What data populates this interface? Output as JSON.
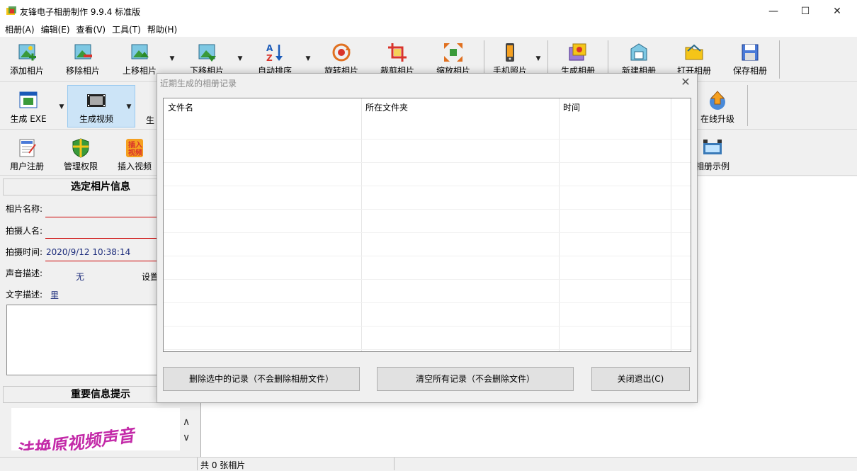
{
  "app": {
    "title": "友锋电子相册制作 9.9.4 标准版",
    "window_buttons": [
      "—",
      "☐",
      "✕"
    ]
  },
  "menu": [
    "相册(A)",
    "编辑(E)",
    "查看(V)",
    "工具(T)",
    "帮助(H)"
  ],
  "toolbar1": [
    {
      "label": "添加相片"
    },
    {
      "label": "移除相片"
    },
    {
      "label": "上移相片"
    },
    {
      "label": "下移相片"
    },
    {
      "label": "自动排序"
    },
    {
      "label": "旋转相片"
    },
    {
      "label": "裁剪相片"
    },
    {
      "label": "缩放相片"
    },
    {
      "label": "手机照片"
    },
    {
      "label": "生成相册"
    },
    {
      "label": "新建相册"
    },
    {
      "label": "打开相册"
    },
    {
      "label": "保存相册"
    }
  ],
  "toolbar2": [
    {
      "label": "生成 EXE"
    },
    {
      "label": "生成视频"
    },
    {
      "label": "生"
    },
    {
      "label": "在线升级"
    }
  ],
  "toolbar3": [
    {
      "label": "用户注册"
    },
    {
      "label": "管理权限"
    },
    {
      "label": "插入视频"
    },
    {
      "label": "相册示例"
    }
  ],
  "info_panel": {
    "header": "选定相片信息",
    "name_label": "相片名称:",
    "shooter_label": "拍摄人名:",
    "time_label": "拍摄时间:",
    "time_value": "2020/9/12 10:38:14",
    "sound_label": "声音描述:",
    "sound_value": "无",
    "sound_setting": "设置",
    "text_label": "文字描述:",
    "text_value": "里"
  },
  "notice_panel": {
    "header": "重要信息提示",
    "banner_text": "法换原视频声音"
  },
  "dialog": {
    "title": "近期生成的相册记录",
    "columns": [
      "文件名",
      "所在文件夹",
      "时间"
    ],
    "buttons": {
      "delete_selected": "删除选中的记录（不会删除相册文件）",
      "clear_all": "清空所有记录（不会删除文件）",
      "close": "关闭退出(C)"
    }
  },
  "status": {
    "photo_count": "共 0 张相片"
  }
}
